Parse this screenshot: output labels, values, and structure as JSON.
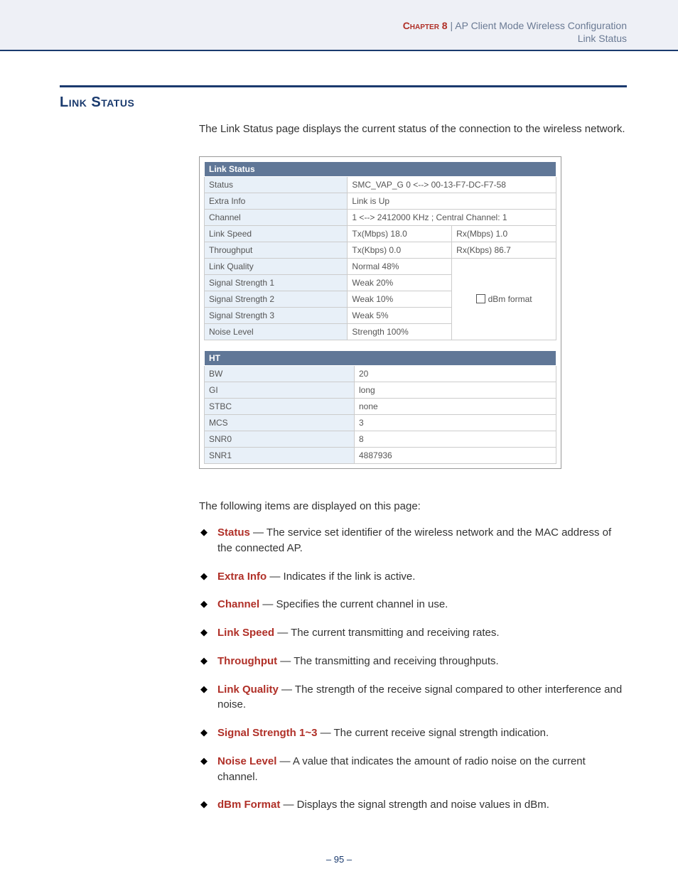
{
  "header": {
    "chapter_label": "Chapter 8",
    "chapter_sep": "  |  ",
    "chapter_title": "AP Client Mode Wireless Configuration",
    "subtitle": "Link Status"
  },
  "section_title": "Link Status",
  "intro": "The Link Status page displays the current status of the connection to the wireless network.",
  "linkstatus": {
    "header": "Link Status",
    "rows": {
      "status_lab": "Status",
      "status_val": "SMC_VAP_G 0 <--> 00-13-F7-DC-F7-58",
      "extra_lab": "Extra Info",
      "extra_val": "Link is Up",
      "channel_lab": "Channel",
      "channel_val": "1 <--> 2412000 KHz ; Central Channel:  1",
      "linkspeed_lab": "Link Speed",
      "linkspeed_tx": "Tx(Mbps)  18.0",
      "linkspeed_rx": "Rx(Mbps)  1.0",
      "throughput_lab": "Throughput",
      "throughput_tx": "Tx(Kbps)  0.0",
      "throughput_rx": "Rx(Kbps)  86.7",
      "lq_lab": "Link Quality",
      "lq_val": "Normal     48%",
      "ss1_lab": "Signal Strength 1",
      "ss1_val": "Weak     20%",
      "ss2_lab": "Signal Strength 2",
      "ss2_val": "Weak     10%",
      "ss3_lab": "Signal Strength 3",
      "ss3_val": "Weak      5%",
      "noise_lab": "Noise Level",
      "noise_val": "Strength     100%",
      "dbm_label": "dBm format"
    }
  },
  "ht": {
    "header": "HT",
    "rows": {
      "bw_lab": "BW",
      "bw_val": "20",
      "gi_lab": "GI",
      "gi_val": "long",
      "stbc_lab": "STBC",
      "stbc_val": "none",
      "mcs_lab": "MCS",
      "mcs_val": "3",
      "snr0_lab": "SNR0",
      "snr0_val": "8",
      "snr1_lab": "SNR1",
      "snr1_val": "4887936"
    }
  },
  "followup_text": "The following items are displayed on this page:",
  "bullets": [
    {
      "t": "Status",
      "d": " — The service set identifier of the wireless network and the MAC address of the connected AP."
    },
    {
      "t": "Extra Info",
      "d": " — Indicates if the link is active."
    },
    {
      "t": "Channel",
      "d": " — Specifies the current channel in use."
    },
    {
      "t": "Link Speed",
      "d": " — The current transmitting and receiving rates."
    },
    {
      "t": "Throughput",
      "d": " — The transmitting and receiving throughputs."
    },
    {
      "t": "Link Quality",
      "d": " — The strength of the receive signal compared to other interference and noise."
    },
    {
      "t": "Signal Strength 1~3",
      "d": " — The current receive signal strength indication."
    },
    {
      "t": "Noise Level",
      "d": " — A value that indicates the amount of radio noise on the current channel."
    },
    {
      "t": "dBm Format",
      "d": " — Displays the signal strength and noise values in dBm."
    }
  ],
  "footer": "–  95  –"
}
